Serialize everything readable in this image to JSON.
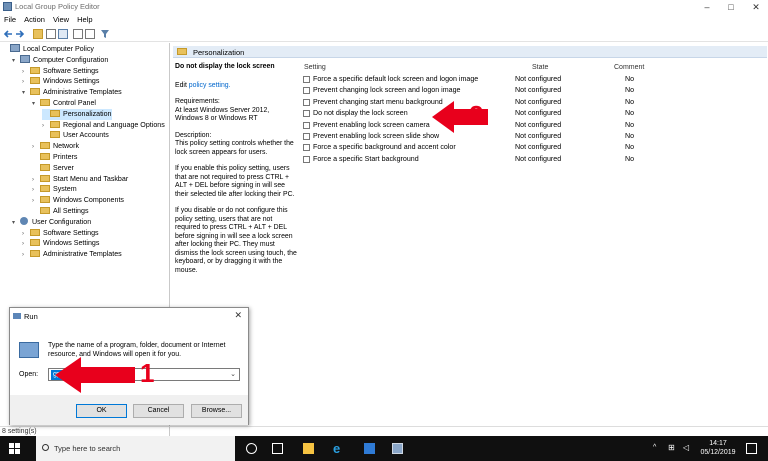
{
  "window": {
    "title": "Local Group Policy Editor",
    "menu": [
      "File",
      "Action",
      "View",
      "Help"
    ]
  },
  "tree": {
    "items": [
      {
        "label": "Local Computer Policy",
        "indent": 0,
        "icon": "pc-icon",
        "arrow": ""
      },
      {
        "label": "Computer Configuration",
        "indent": 1,
        "icon": "pc-icon",
        "arrow": "▾"
      },
      {
        "label": "Software Settings",
        "indent": 2,
        "icon": "folder-icon",
        "arrow": "›"
      },
      {
        "label": "Windows Settings",
        "indent": 2,
        "icon": "folder-icon",
        "arrow": "›"
      },
      {
        "label": "Administrative Templates",
        "indent": 2,
        "icon": "folder-icon",
        "arrow": "▾"
      },
      {
        "label": "Control Panel",
        "indent": 3,
        "icon": "folder-icon",
        "arrow": "▾"
      },
      {
        "label": "Personalization",
        "indent": 4,
        "icon": "folder-icon",
        "arrow": "",
        "selected": true
      },
      {
        "label": "Regional and Language Options",
        "indent": 4,
        "icon": "folder-icon",
        "arrow": "›"
      },
      {
        "label": "User Accounts",
        "indent": 4,
        "icon": "folder-icon",
        "arrow": ""
      },
      {
        "label": "Network",
        "indent": 3,
        "icon": "folder-icon",
        "arrow": "›"
      },
      {
        "label": "Printers",
        "indent": 3,
        "icon": "folder-icon",
        "arrow": ""
      },
      {
        "label": "Server",
        "indent": 3,
        "icon": "folder-icon",
        "arrow": ""
      },
      {
        "label": "Start Menu and Taskbar",
        "indent": 3,
        "icon": "folder-icon",
        "arrow": "›"
      },
      {
        "label": "System",
        "indent": 3,
        "icon": "folder-icon",
        "arrow": "›"
      },
      {
        "label": "Windows Components",
        "indent": 3,
        "icon": "folder-icon",
        "arrow": "›"
      },
      {
        "label": "All Settings",
        "indent": 3,
        "icon": "folder-icon",
        "arrow": ""
      },
      {
        "label": "User Configuration",
        "indent": 1,
        "icon": "user-icon",
        "arrow": "▾"
      },
      {
        "label": "Software Settings",
        "indent": 2,
        "icon": "folder-icon",
        "arrow": "›"
      },
      {
        "label": "Windows Settings",
        "indent": 2,
        "icon": "folder-icon",
        "arrow": "›"
      },
      {
        "label": "Administrative Templates",
        "indent": 2,
        "icon": "folder-icon",
        "arrow": "›"
      }
    ]
  },
  "header": {
    "title": "Personalization"
  },
  "description": {
    "heading": "Do not display the lock screen",
    "edit_prefix": "Edit",
    "edit_link": "policy setting.",
    "requirements": "Requirements:\nAt least Windows Server 2012, Windows 8 or Windows RT",
    "description": "Description:\nThis policy setting controls whether the lock screen appears for users.",
    "para1": "If you enable this policy setting, users that are not required to press CTRL + ALT + DEL before signing in will see their selected tile after locking their PC.",
    "para2": "If you disable or do not configure this policy setting, users that are not required to press CTRL + ALT + DEL before signing in will see a lock screen after locking their PC. They must dismiss the lock screen using touch, the keyboard, or by dragging it with the mouse."
  },
  "grid": {
    "columns": {
      "setting": "Setting",
      "state": "State",
      "comment": "Comment"
    },
    "rows": [
      {
        "setting": "Force a specific default lock screen and logon image",
        "state": "Not configured",
        "comment": "No"
      },
      {
        "setting": "Prevent changing lock screen and logon image",
        "state": "Not configured",
        "comment": "No"
      },
      {
        "setting": "Prevent changing start menu background",
        "state": "Not configured",
        "comment": "No"
      },
      {
        "setting": "Do not display the lock screen",
        "state": "Not configured",
        "comment": "No"
      },
      {
        "setting": "Prevent enabling lock screen camera",
        "state": "Not configured",
        "comment": "No"
      },
      {
        "setting": "Prevent enabling lock screen slide show",
        "state": "Not configured",
        "comment": "No"
      },
      {
        "setting": "Force a specific background and accent color",
        "state": "Not configured",
        "comment": "No"
      },
      {
        "setting": "Force a specific Start background",
        "state": "Not configured",
        "comment": "No"
      }
    ]
  },
  "statusbar": {
    "text": "8 setting(s)"
  },
  "run_dialog": {
    "title": "Run",
    "message": "Type the name of a program, folder, document or Internet resource, and Windows will open it for you.",
    "open_label": "Open:",
    "open_value": "gpedit.msc",
    "ok": "OK",
    "cancel": "Cancel",
    "browse": "Browse..."
  },
  "annotations": {
    "arrow1_label": "1",
    "arrow2_label": "2",
    "color": "#e8001c"
  },
  "taskbar": {
    "search_placeholder": "Type here to search",
    "time": "14:17",
    "date": "05/12/2019"
  }
}
